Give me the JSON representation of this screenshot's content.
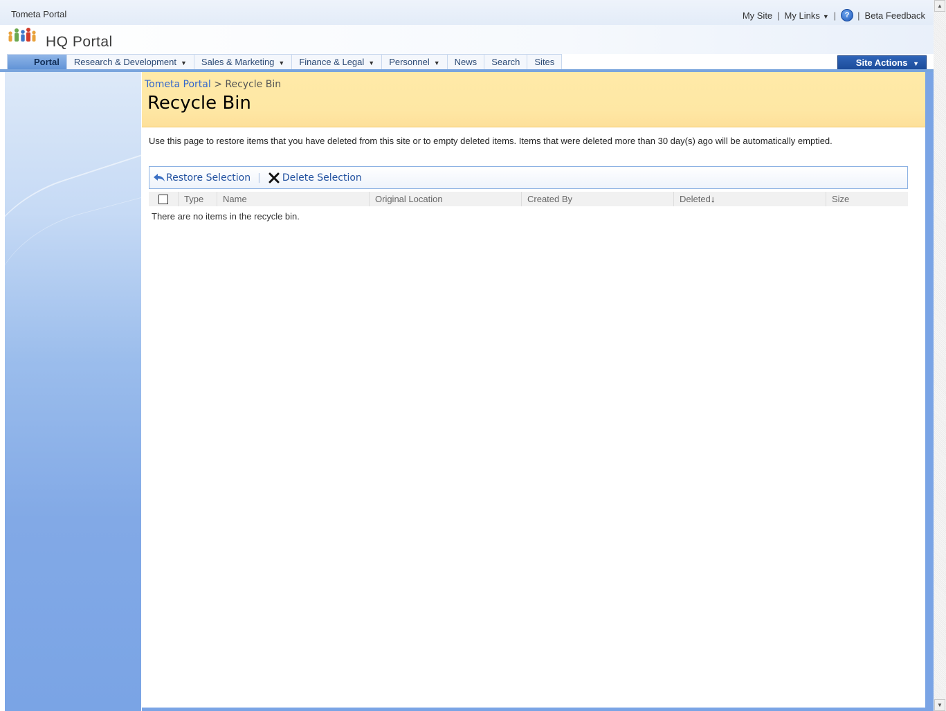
{
  "topbar": {
    "site_name": "Tometa Portal",
    "my_site": "My Site",
    "my_links": "My Links",
    "beta_feedback": "Beta Feedback",
    "separator": "|"
  },
  "header": {
    "title": "HQ Portal"
  },
  "nav": {
    "tabs": [
      {
        "label": "Portal",
        "active": true,
        "dropdown": false
      },
      {
        "label": "Research & Development",
        "dropdown": true
      },
      {
        "label": "Sales & Marketing",
        "dropdown": true
      },
      {
        "label": "Finance & Legal",
        "dropdown": true
      },
      {
        "label": "Personnel",
        "dropdown": true
      },
      {
        "label": "News",
        "dropdown": false
      },
      {
        "label": "Search",
        "dropdown": false
      },
      {
        "label": "Sites",
        "dropdown": false
      }
    ],
    "site_actions": "Site Actions"
  },
  "breadcrumb": {
    "root": "Tometa Portal",
    "separator": ">",
    "current": "Recycle Bin"
  },
  "page": {
    "title": "Recycle Bin",
    "description": "Use this page to restore items that you have deleted from this site or to empty deleted items. Items that were deleted more than 30 day(s) ago will be automatically emptied."
  },
  "toolbar": {
    "restore": "Restore Selection",
    "separator": "|",
    "delete": "Delete Selection"
  },
  "grid": {
    "columns": [
      "Type",
      "Name",
      "Original Location",
      "Created By",
      "Deleted",
      "Size"
    ],
    "sort_indicator": "↓",
    "empty_message": "There are no items in the recycle bin."
  },
  "colors": {
    "accent_blue": "#1c4c9a",
    "title_band": "#ffeaa8",
    "link": "#3366cc"
  }
}
